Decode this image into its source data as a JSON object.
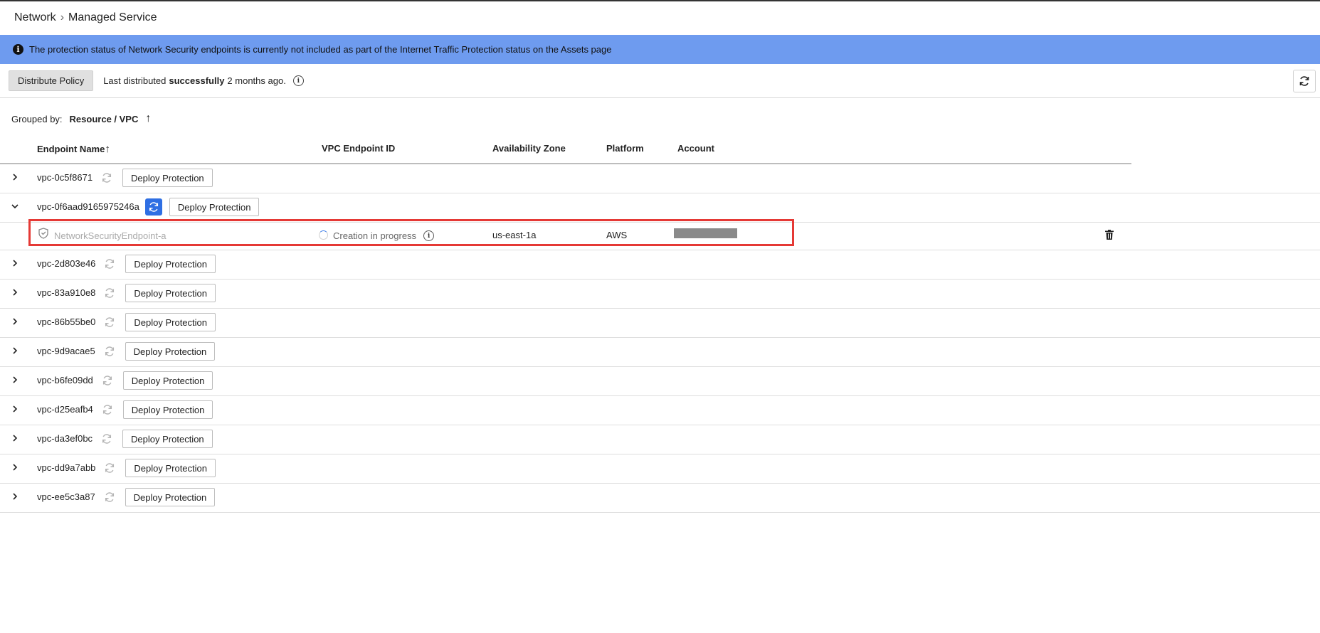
{
  "breadcrumb": {
    "root": "Network",
    "current": "Managed Service"
  },
  "banner": {
    "text": "The protection status of Network Security endpoints is currently not included as part of the Internet Traffic Protection status on the Assets page"
  },
  "toolbar": {
    "distribute_label": "Distribute Policy",
    "last_prefix": "Last distributed",
    "last_status": "successfully",
    "last_suffix": "2 months ago."
  },
  "grouping": {
    "label": "Grouped by:",
    "value": "Resource / VPC"
  },
  "columns": {
    "endpoint_name": "Endpoint Name",
    "vpc_endpoint_id": "VPC Endpoint ID",
    "availability_zone": "Availability Zone",
    "platform": "Platform",
    "account": "Account"
  },
  "deploy_label": "Deploy Protection",
  "rows": [
    {
      "name": "vpc-0c5f8671",
      "expanded": false,
      "active": false
    },
    {
      "name": "vpc-0f6aad9165975246a",
      "expanded": true,
      "active": true
    },
    {
      "name": "vpc-2d803e46",
      "expanded": false,
      "active": false
    },
    {
      "name": "vpc-83a910e8",
      "expanded": false,
      "active": false
    },
    {
      "name": "vpc-86b55be0",
      "expanded": false,
      "active": false
    },
    {
      "name": "vpc-9d9acae5",
      "expanded": false,
      "active": false
    },
    {
      "name": "vpc-b6fe09dd",
      "expanded": false,
      "active": false
    },
    {
      "name": "vpc-d25eafb4",
      "expanded": false,
      "active": false
    },
    {
      "name": "vpc-da3ef0bc",
      "expanded": false,
      "active": false
    },
    {
      "name": "vpc-dd9a7abb",
      "expanded": false,
      "active": false
    },
    {
      "name": "vpc-ee5c3a87",
      "expanded": false,
      "active": false
    }
  ],
  "endpoint": {
    "name": "NetworkSecurityEndpoint-a",
    "status": "Creation in progress",
    "availability_zone": "us-east-1a",
    "platform": "AWS"
  },
  "colors": {
    "banner": "#6e9bef",
    "active_sync": "#2f6fe3",
    "highlight": "#e53935"
  }
}
